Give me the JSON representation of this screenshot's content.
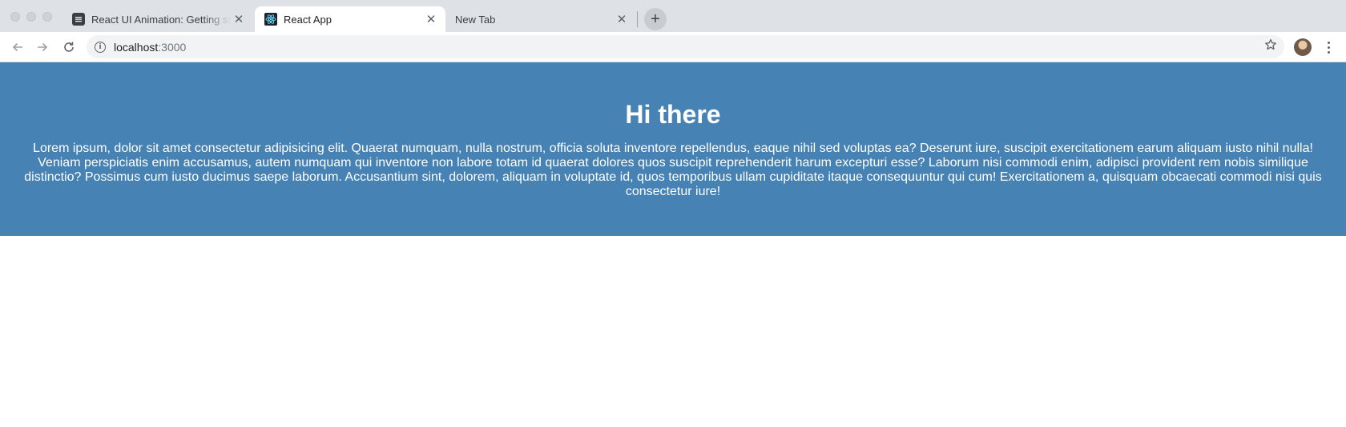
{
  "browser": {
    "tabs": [
      {
        "title": "React UI Animation: Getting started",
        "favicon": "doc-icon",
        "active": false
      },
      {
        "title": "React App",
        "favicon": "react-logo-icon",
        "active": true
      },
      {
        "title": "New Tab",
        "favicon": "",
        "active": false
      }
    ],
    "new_tab_label": "+",
    "address": {
      "host": "localhost",
      "port": ":3000"
    }
  },
  "page": {
    "heading": "Hi there",
    "body": "Lorem ipsum, dolor sit amet consectetur adipisicing elit. Quaerat numquam, nulla nostrum, officia soluta inventore repellendus, eaque nihil sed voluptas ea? Deserunt iure, suscipit exercitationem earum aliquam iusto nihil nulla! Veniam perspiciatis enim accusamus, autem numquam qui inventore non labore totam id quaerat dolores quos suscipit reprehenderit harum excepturi esse? Laborum nisi commodi enim, adipisci provident rem nobis similique distinctio? Possimus cum iusto ducimus saepe laborum. Accusantium sint, dolorem, aliquam in voluptate id, quos temporibus ullam cupiditate itaque consequuntur qui cum! Exercitationem a, quisquam obcaecati commodi nisi quis consectetur iure!",
    "banner_color": "#4682b4"
  }
}
